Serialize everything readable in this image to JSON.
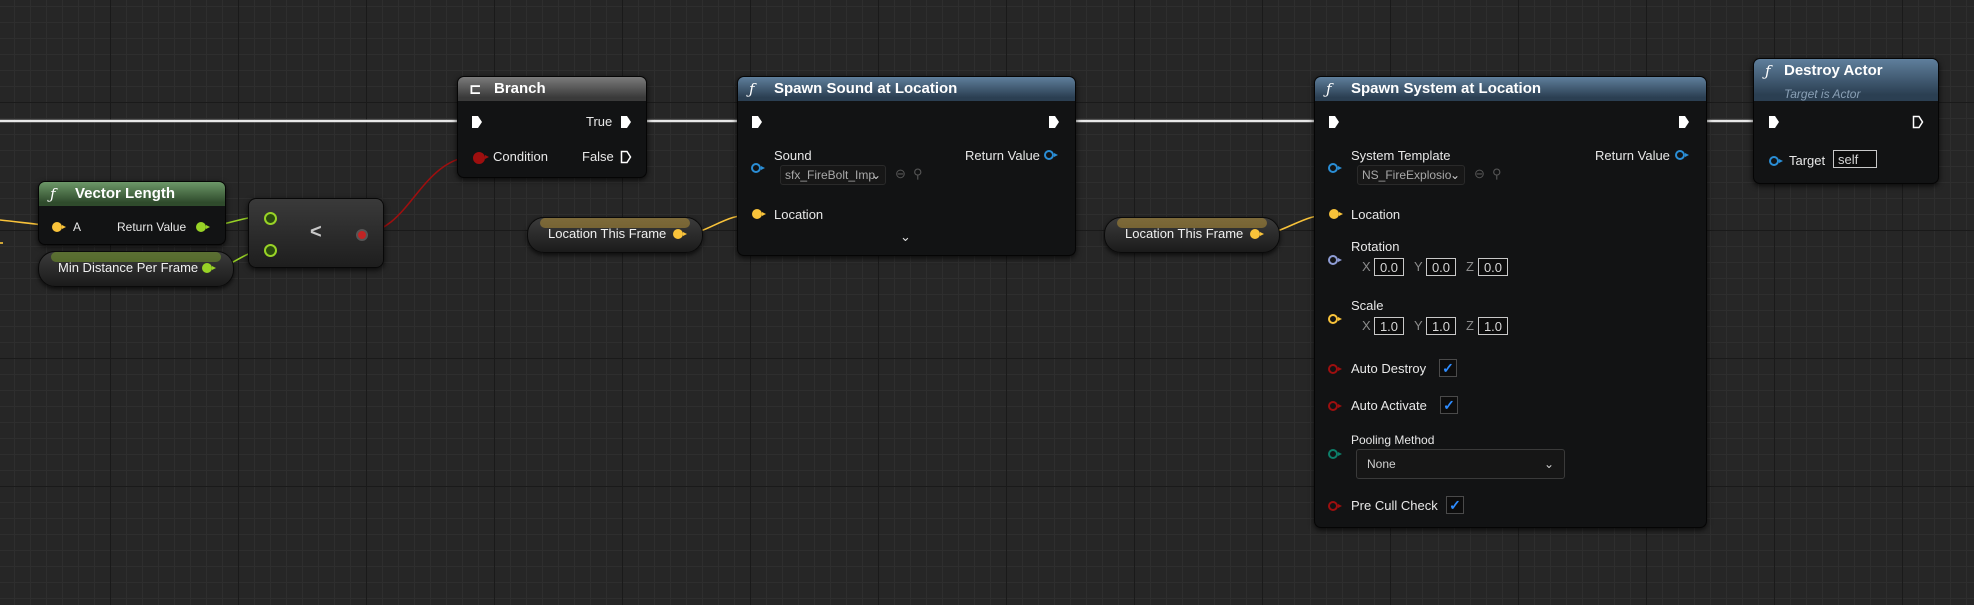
{
  "colors": {
    "exec_wire": "#ffffff",
    "float_pin": "#98d326",
    "vector_pin": "#f9c33a",
    "bool_pin": "#9e0f0f",
    "object_pin": "#2a8ed6",
    "rotator_pin": "#8f9dd6",
    "enum_pin": "#0d7f6a",
    "checkbox_accent": "#2e8cff"
  },
  "vector_length": {
    "title": "Vector Length",
    "input_a": "A",
    "output": "Return Value"
  },
  "min_distance": {
    "label": "Min Distance Per Frame"
  },
  "compare": {
    "operator": "<"
  },
  "branch": {
    "title": "Branch",
    "true_label": "True",
    "false_label": "False",
    "condition_label": "Condition"
  },
  "location_var_1": {
    "label": "Location This Frame"
  },
  "location_var_2": {
    "label": "Location This Frame"
  },
  "spawn_sound": {
    "title": "Spawn Sound at Location",
    "sound_label": "Sound",
    "sound_value": "sfx_FireBolt_Imp",
    "return_label": "Return Value",
    "location_label": "Location",
    "expand_glyph": "⌄"
  },
  "spawn_system": {
    "title": "Spawn System at Location",
    "template_label": "System Template",
    "template_value": "NS_FireExplosio",
    "return_label": "Return Value",
    "location_label": "Location",
    "rotation_label": "Rotation",
    "rotation": {
      "x_label": "X",
      "x": "0.0",
      "y_label": "Y",
      "y": "0.0",
      "z_label": "Z",
      "z": "0.0"
    },
    "scale_label": "Scale",
    "scale": {
      "x_label": "X",
      "x": "1.0",
      "y_label": "Y",
      "y": "1.0",
      "z_label": "Z",
      "z": "1.0"
    },
    "auto_destroy_label": "Auto Destroy",
    "auto_destroy": true,
    "auto_activate_label": "Auto Activate",
    "auto_activate": true,
    "pooling_label": "Pooling Method",
    "pooling_value": "None",
    "pre_cull_label": "Pre Cull Check",
    "pre_cull": true
  },
  "destroy_actor": {
    "title": "Destroy Actor",
    "subtitle": "Target is Actor",
    "target_label": "Target",
    "target_value": "self"
  },
  "icons": {
    "function": "ƒ",
    "branch": "⊏",
    "check": "✓",
    "chevron": "⌄"
  }
}
